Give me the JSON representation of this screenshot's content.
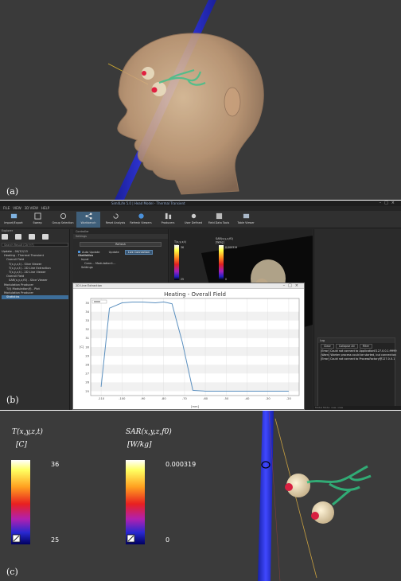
{
  "panels": {
    "a": {
      "label": "(a)"
    },
    "b": {
      "label": "(b)",
      "window_title": "Sim4Life 5.0 | Head Model - Thermal Transient",
      "menu": [
        "FILE",
        "VIEW",
        "3D VIEW",
        "HELP"
      ],
      "ribbon": [
        {
          "label": "Import/Export",
          "icon": "import-export-icon"
        },
        {
          "label": "Sweep",
          "icon": "sweep-icon"
        },
        {
          "label": "Group Selection",
          "icon": "group-selection-icon"
        },
        {
          "label": "Workbench",
          "icon": "workbench-icon",
          "active": true
        },
        {
          "label": "Reset Analysis",
          "icon": "reset-analysis-icon"
        },
        {
          "label": "Refresh Viewers",
          "icon": "refresh-viewers-icon"
        },
        {
          "label": "Producers",
          "icon": "producers-icon"
        },
        {
          "label": "User Defined",
          "icon": "user-defined-icon"
        },
        {
          "label": "Field Data Tools",
          "icon": "field-data-tools-icon"
        },
        {
          "label": "Table Viewer",
          "icon": "table-viewer-icon"
        }
      ],
      "explorer": {
        "header": "Explorer",
        "search_placeholder": "Search Result (Ctrl+F)",
        "tree": [
          "Update - 04/12/13",
          "Heating - Thermal Transient",
          "Overall Field",
          "T(x,y,z,t) - Slice Viewer",
          "T(x,y,z,t) - 2D Line Extraction",
          "T(x,y,z,t) - 2D Line Viewer",
          "Overall Field",
          "SAR(x,y,z,f0) - Slice Viewer",
          "Modulation Producer",
          "T(t) Modulation(f) - Plot",
          "Modulation Producer",
          "Statistics"
        ]
      },
      "controller": {
        "header": "Controller",
        "tab": "Settings",
        "refresh": "Refresh",
        "auto_update": "Auto Update",
        "update": "Update",
        "live_connection": "Live Connection",
        "rows": [
          "Statistics",
          "Input",
          "Conn... Modulation1...",
          "Settings"
        ]
      },
      "plot": {
        "window_title": "2D Line Extraction",
        "title": "Heating - Overall Field",
        "ylabel": "[C]",
        "xlabel": "[mm]",
        "x_ticks": [
          "-110",
          "-100",
          "-90",
          "-80",
          "-70",
          "-60",
          "-50",
          "-40",
          "-30",
          "-20"
        ],
        "y_ticks": [
          "25",
          "26",
          "27",
          "28",
          "29",
          "30",
          "31",
          "32",
          "33",
          "34",
          "35"
        ]
      },
      "viewer_colorbars": [
        {
          "title": "T(x,y,z,t)",
          "unit": "[C]",
          "max": "36",
          "min": "25"
        },
        {
          "title": "SAR(x,y,z,f0)",
          "unit": "[W/kg]",
          "max": "0.000319",
          "min": "0"
        }
      ],
      "log": {
        "header": "Log",
        "buttons": [
          "Clear",
          "Collapse All",
          "Filter"
        ],
        "lines": [
          "[Error] Could not connect to ApplicationE127.0.0.1:9999",
          "[Warn] Worker process could be started, but connection",
          "[Error] Could not connect to ProcessFactory@127.0.0.1"
        ]
      },
      "status": "Model Mode: new, view"
    },
    "c": {
      "label": "(c)",
      "colorbars": [
        {
          "title": "T(x,y,z,t)",
          "unit": "[C]",
          "max": "36",
          "min": "25"
        },
        {
          "title": "SAR(x,y,z,f0)",
          "unit": "[W/kg]",
          "max": "0.000319",
          "min": "0"
        }
      ]
    }
  },
  "chart_data": {
    "type": "line",
    "title": "Heating - Overall Field",
    "xlabel": "[mm]",
    "ylabel": "[C]",
    "xlim": [
      -115,
      -15
    ],
    "ylim": [
      24.5,
      35.5
    ],
    "series": [
      {
        "x": [
          -110,
          -106,
          -100,
          -95,
          -90,
          -84,
          -80,
          -76,
          -71,
          -66,
          -60,
          -40,
          -20
        ],
        "values": [
          25.5,
          34.4,
          35.0,
          35.1,
          35.1,
          35.0,
          35.1,
          34.9,
          30.5,
          25.1,
          25.0,
          25.0,
          25.0
        ]
      }
    ],
    "grid": true,
    "legend": "top-left"
  },
  "colors": {
    "accent": "#3d6e9a",
    "line": "#5a8fbf",
    "rod": "#2a2fd0"
  }
}
